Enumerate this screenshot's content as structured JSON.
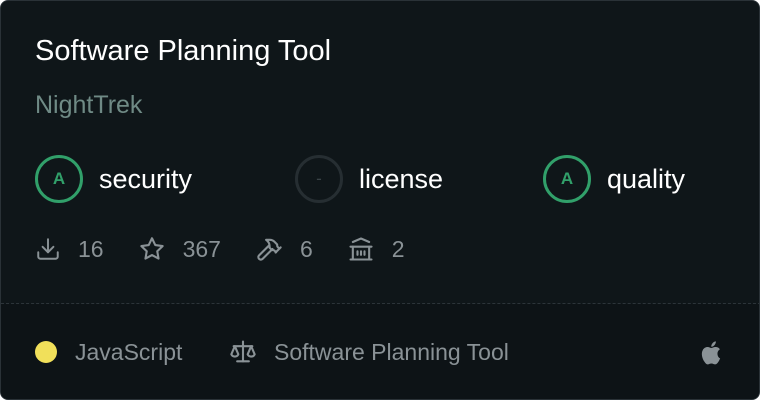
{
  "repo": {
    "title": "Software Planning Tool",
    "owner": "NightTrek"
  },
  "scores": [
    {
      "grade": "A",
      "label": "security"
    },
    {
      "grade": "-",
      "label": "license"
    },
    {
      "grade": "A",
      "label": "quality"
    }
  ],
  "stats": {
    "downloads": "16",
    "stars": "367",
    "tools": "6",
    "institutions": "2"
  },
  "footer": {
    "language": "JavaScript",
    "language_color": "#f1e05a",
    "license_name": "Software Planning Tool",
    "platform_icon": "apple-icon"
  },
  "colors": {
    "background": "#0f1619",
    "grade_green": "#31a06a",
    "muted_text": "#8a9296"
  }
}
